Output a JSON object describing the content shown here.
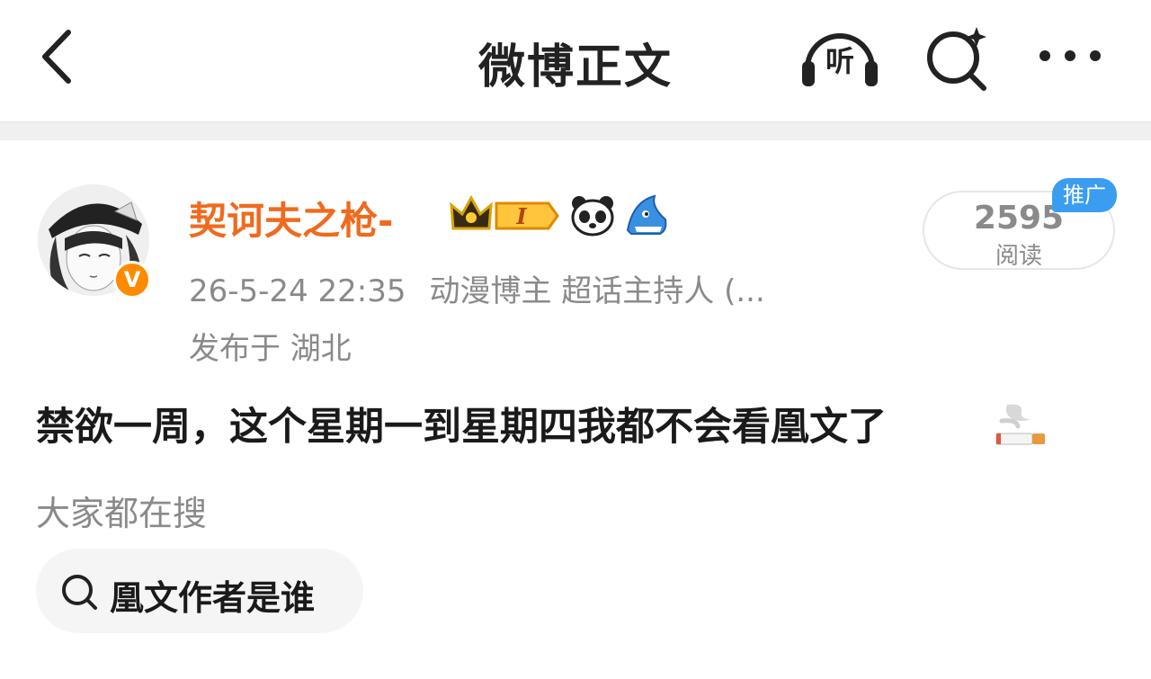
{
  "header": {
    "title": "微博正文",
    "listen_label": "听"
  },
  "post": {
    "username": "契诃夫之枪-",
    "badge_level": "I",
    "time": "26-5-24 22:35",
    "user_tags": "动漫博主 超话主持人 (...",
    "location": "发布于 湖北",
    "read_count": "2595",
    "read_label": "阅读",
    "promo_badge": "推广",
    "content": "禁欲一周，这个星期一到星期四我都不会看凰文了",
    "content_emoji": "cigarette-emoji"
  },
  "hot_search": {
    "title": "大家都在搜",
    "items": [
      {
        "label": "凰文作者是谁"
      }
    ]
  },
  "colors": {
    "username": "#f06a1e",
    "promo": "#3b9df0",
    "verified": "#ff8a00",
    "muted": "#8a8a8a"
  }
}
